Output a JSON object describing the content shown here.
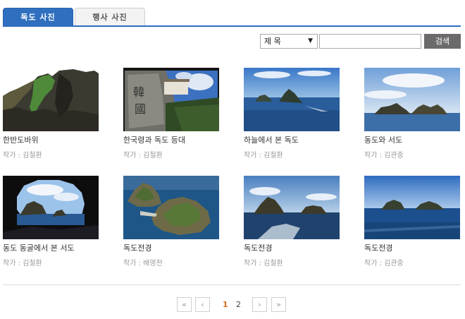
{
  "tabs": [
    {
      "label": "독도 사진",
      "active": true
    },
    {
      "label": "행사 사진",
      "active": false
    }
  ],
  "search": {
    "select_value": "제 목",
    "input_value": "",
    "button_label": "검색"
  },
  "gallery": [
    {
      "title": "한반도바위",
      "author": "작가 : 김철환"
    },
    {
      "title": "한국령과 독도 등대",
      "author": "작가 : 김철환"
    },
    {
      "title": "하늘에서 본 독도",
      "author": "작가 : 김철환"
    },
    {
      "title": "동도와 서도",
      "author": "작가 : 김관중"
    },
    {
      "title": "동도 동굴에서 본 서도",
      "author": "작가 : 김철환"
    },
    {
      "title": "독도전경",
      "author": "작가 : 배영천"
    },
    {
      "title": "독도전경",
      "author": "작가 : 김철환"
    },
    {
      "title": "독도전경",
      "author": "작가 : 김관중"
    }
  ],
  "pagination": {
    "first": "«",
    "prev": "‹",
    "pages": [
      "1",
      "2"
    ],
    "current": "1",
    "next": "›",
    "last": "»"
  },
  "colors": {
    "accent": "#2f6fc0",
    "current_page": "#e06b1b",
    "search_button": "#6b6b6b"
  }
}
